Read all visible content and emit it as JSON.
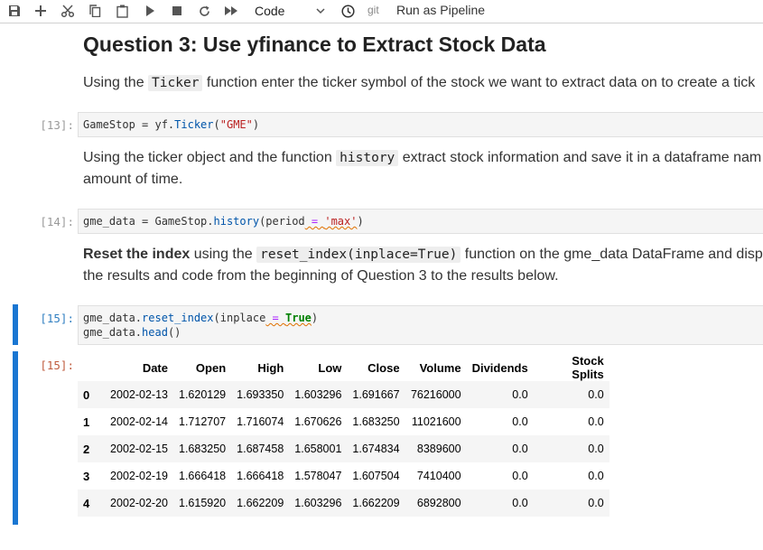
{
  "toolbar": {
    "cell_type": "Code",
    "git_label": "git",
    "run_pipeline": "Run as Pipeline"
  },
  "question": {
    "title": "Question 3: Use yfinance to Extract Stock Data",
    "p1_pre": "Using the ",
    "p1_code": "Ticker",
    "p1_post": " function enter the ticker symbol of the stock we want to extract data on to create a tick",
    "p2_pre": "Using the ticker object and the function ",
    "p2_code": "history",
    "p2_post": " extract stock information and save it in a dataframe nam",
    "p2_line2": "amount of time.",
    "p3_bold": "Reset the index",
    "p3_mid": " using the ",
    "p3_code": "reset_index(inplace=True)",
    "p3_post": " function on the gme_data DataFrame and disp",
    "p3_line2": "the results and code from the beginning of Question 3 to the results below."
  },
  "cells": {
    "c13_prompt": "[13]:",
    "c13_a": "GameStop = yf.",
    "c13_b": "Ticker",
    "c13_c": "(",
    "c13_d": "\"GME\"",
    "c13_e": ")",
    "c14_prompt": "[14]:",
    "c14_a": "gme_data = GameStop.",
    "c14_b": "history",
    "c14_c": "(period",
    "c14_d": " = ",
    "c14_e": "'max'",
    "c14_f": ")",
    "c15_prompt": "[15]:",
    "c15_l1a": "gme_data.",
    "c15_l1b": "reset_index",
    "c15_l1c": "(inplace",
    "c15_l1d": " = ",
    "c15_l1e": "True",
    "c15_l1f": ")",
    "c15_l2a": "gme_data.",
    "c15_l2b": "head",
    "c15_l2c": "()",
    "out15_prompt": "[15]:"
  },
  "table": {
    "columns": [
      "",
      "Date",
      "Open",
      "High",
      "Low",
      "Close",
      "Volume",
      "Dividends",
      "Stock Splits"
    ],
    "rows": [
      [
        "0",
        "2002-02-13",
        "1.620129",
        "1.693350",
        "1.603296",
        "1.691667",
        "76216000",
        "0.0",
        "0.0"
      ],
      [
        "1",
        "2002-02-14",
        "1.712707",
        "1.716074",
        "1.670626",
        "1.683250",
        "11021600",
        "0.0",
        "0.0"
      ],
      [
        "2",
        "2002-02-15",
        "1.683250",
        "1.687458",
        "1.658001",
        "1.674834",
        "8389600",
        "0.0",
        "0.0"
      ],
      [
        "3",
        "2002-02-19",
        "1.666418",
        "1.666418",
        "1.578047",
        "1.607504",
        "7410400",
        "0.0",
        "0.0"
      ],
      [
        "4",
        "2002-02-20",
        "1.615920",
        "1.662209",
        "1.603296",
        "1.662209",
        "6892800",
        "0.0",
        "0.0"
      ]
    ]
  }
}
